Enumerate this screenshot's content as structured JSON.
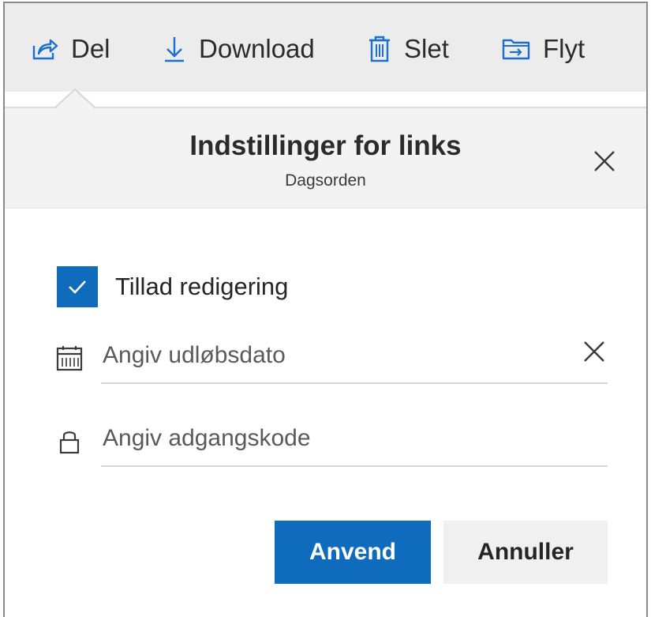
{
  "toolbar": {
    "share_label": "Del",
    "download_label": "Download",
    "delete_label": "Slet",
    "move_label": "Flyt"
  },
  "panel": {
    "title": "Indstillinger for links",
    "subtitle": "Dagsorden"
  },
  "options": {
    "allow_editing_label": "Tillad redigering",
    "allow_editing_checked": true,
    "expiry_placeholder": "Angiv udløbsdato",
    "expiry_value": "",
    "password_placeholder": "Angiv adgangskode",
    "password_value": ""
  },
  "actions": {
    "apply_label": "Anvend",
    "cancel_label": "Annuller"
  },
  "colors": {
    "accent": "#0f6cbd",
    "toolbar_bg": "#ececec",
    "header_bg": "#f3f3f3",
    "icon_blue": "#1a6fcf"
  }
}
